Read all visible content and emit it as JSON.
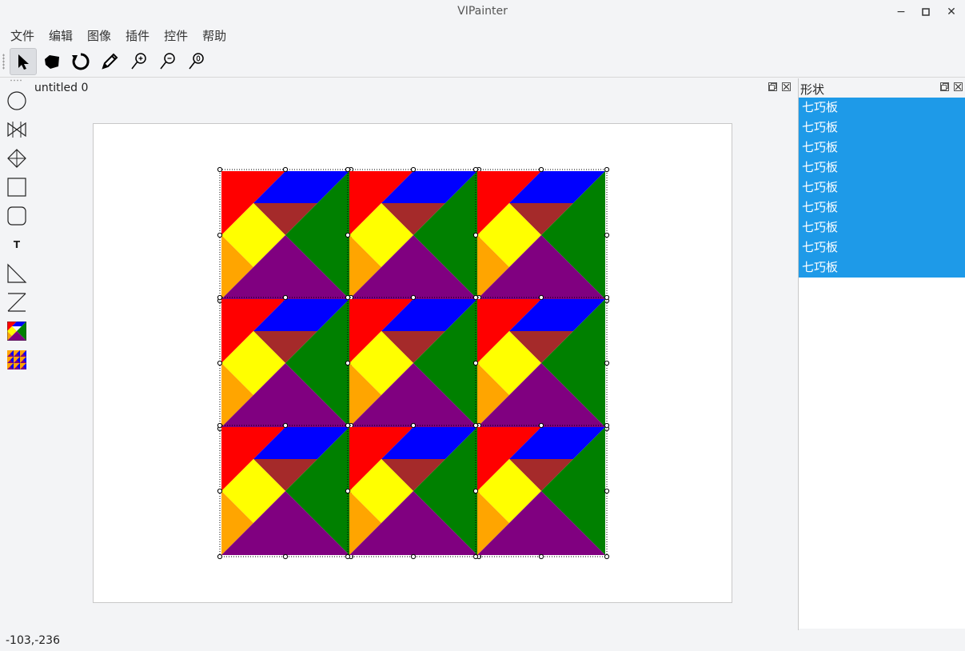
{
  "window": {
    "title": "VIPainter",
    "minimize_glyph": "−",
    "maximize_glyph": "▫",
    "close_glyph": "✕"
  },
  "menu": [
    "文件",
    "编辑",
    "图像",
    "插件",
    "控件",
    "帮助"
  ],
  "toolbar": {
    "tools": [
      {
        "name": "select-tool",
        "icon": "arrow-pointer-icon",
        "active": true
      },
      {
        "name": "pan-tool",
        "icon": "hand-icon",
        "active": false
      },
      {
        "name": "rotate-tool",
        "icon": "rotate-icon",
        "active": false
      },
      {
        "name": "pencil-tool",
        "icon": "pencil-icon",
        "active": false
      },
      {
        "name": "zoom-in-tool",
        "icon": "zoom-in-icon",
        "active": false
      },
      {
        "name": "zoom-out-tool",
        "icon": "zoom-out-icon",
        "active": false
      },
      {
        "name": "zoom-reset-tool",
        "icon": "zoom-reset-icon",
        "active": false
      }
    ]
  },
  "left_tools": [
    {
      "name": "circle-tool",
      "icon": "circle-icon"
    },
    {
      "name": "triangle-pair-tool",
      "icon": "triangle-pair-icon"
    },
    {
      "name": "diamond-tool",
      "icon": "diamond-icon"
    },
    {
      "name": "rectangle-tool",
      "icon": "rectangle-icon"
    },
    {
      "name": "rounded-rectangle-tool",
      "icon": "rounded-rectangle-icon"
    },
    {
      "name": "text-tool",
      "icon": "text-icon",
      "label": "T"
    },
    {
      "name": "right-triangle-tool",
      "icon": "right-triangle-icon"
    },
    {
      "name": "z-line-tool",
      "icon": "z-line-icon"
    },
    {
      "name": "tangram-tool",
      "icon": "tangram-icon"
    },
    {
      "name": "tangram-grid-tool",
      "icon": "tangram-grid-icon"
    }
  ],
  "document": {
    "title": "untitled 0"
  },
  "canvas": {
    "grid_rows": 3,
    "grid_cols": 3,
    "piece_colors": {
      "red": "#ff0000",
      "blue": "#0000ff",
      "brown": "#a52a2a",
      "green": "#008000",
      "yellow": "#ffff00",
      "orange": "#ffa500",
      "purple": "#800080"
    }
  },
  "shapes_panel": {
    "title": "形状",
    "items": [
      "七巧板",
      "七巧板",
      "七巧板",
      "七巧板",
      "七巧板",
      "七巧板",
      "七巧板",
      "七巧板",
      "七巧板"
    ],
    "selection_color": "#1e9ae8"
  },
  "status": {
    "text": "-103,-236"
  }
}
